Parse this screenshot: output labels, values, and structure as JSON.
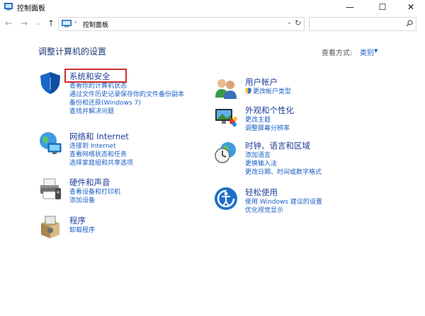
{
  "window": {
    "title": "控制面板",
    "min_glyph": "—",
    "max_glyph": "☐",
    "close_glyph": "✕"
  },
  "nav": {
    "back_glyph": "←",
    "forward_glyph": "→",
    "history_glyph": "⌄",
    "up_glyph": "↑",
    "address_separator": "›",
    "address_text": "控制面板",
    "address_dropdown_glyph": "⌄",
    "refresh_glyph": "↻"
  },
  "main": {
    "heading": "调整计算机的设置",
    "view_by_label": "查看方式:",
    "view_by_value": "类别",
    "view_by_arrow": "▼"
  },
  "categories": [
    {
      "title": "系统和安全",
      "icon": "security-shield-icon",
      "links": [
        "查看你的计算机状态",
        "通过文件历史记录保存你的文件备份副本",
        "备份和还原(Windows 7)",
        "查找并解决问题"
      ]
    },
    {
      "title": "网络和 Internet",
      "icon": "network-globe-icon",
      "links": [
        "连接到 Internet",
        "查看网络状态和任务",
        "选择家庭组和共享选项"
      ]
    },
    {
      "title": "硬件和声音",
      "icon": "printer-icon",
      "links": [
        "查看设备和打印机",
        "添加设备"
      ]
    },
    {
      "title": "程序",
      "icon": "programs-box-icon",
      "links": [
        "卸载程序"
      ]
    },
    {
      "title": "用户帐户",
      "icon": "users-icon",
      "links": [
        "更改帐户类型"
      ]
    },
    {
      "title": "外观和个性化",
      "icon": "appearance-monitor-icon",
      "links": [
        "更改主题",
        "调整屏幕分辨率"
      ]
    },
    {
      "title": "时钟、语言和区域",
      "icon": "clock-globe-icon",
      "links": [
        "添加语言",
        "更换输入法",
        "更改日期、时间或数字格式"
      ]
    },
    {
      "title": "轻松使用",
      "icon": "ease-of-access-icon",
      "links": [
        "使用 Windows 建议的设置",
        "优化视觉显示"
      ]
    }
  ],
  "colors": {
    "link": "#1a5fc4",
    "category_title": "#1f3e9a",
    "heading": "#1e3a78",
    "highlight_border": "#d03030"
  }
}
